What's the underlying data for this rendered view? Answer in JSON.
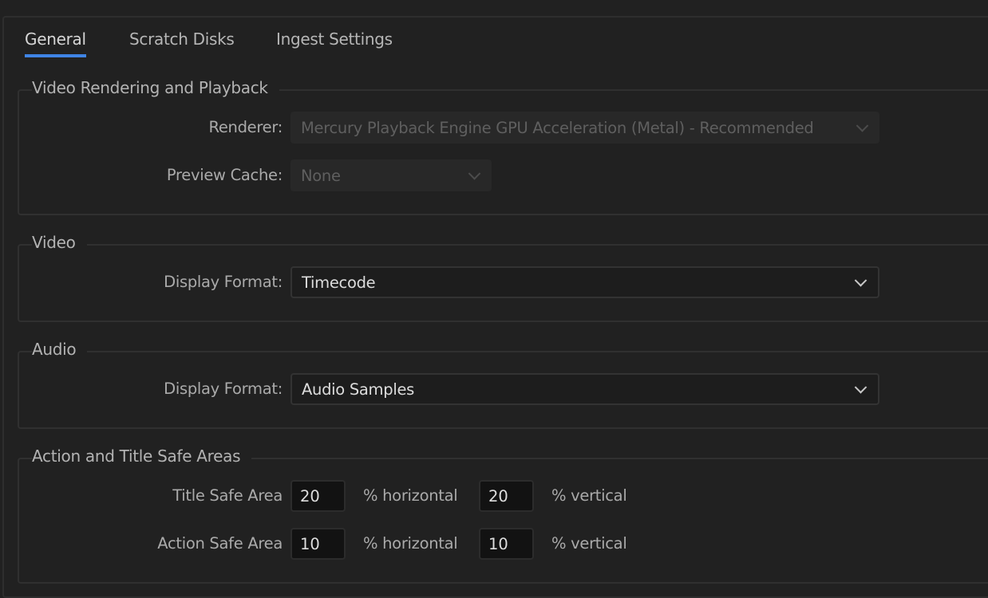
{
  "tabs": [
    {
      "label": "General",
      "active": true
    },
    {
      "label": "Scratch Disks",
      "active": false
    },
    {
      "label": "Ingest Settings",
      "active": false
    }
  ],
  "accent_color": "#3f84e5",
  "groups": {
    "rendering": {
      "title": "Video Rendering and Playback",
      "renderer_label": "Renderer:",
      "renderer_value": "Mercury Playback Engine GPU Acceleration (Metal) - Recommended",
      "preview_cache_label": "Preview Cache:",
      "preview_cache_value": "None"
    },
    "video": {
      "title": "Video",
      "display_format_label": "Display Format:",
      "display_format_value": "Timecode"
    },
    "audio": {
      "title": "Audio",
      "display_format_label": "Display Format:",
      "display_format_value": "Audio Samples"
    },
    "safe_areas": {
      "title": "Action and Title Safe Areas",
      "title_safe": {
        "label": "Title Safe Area",
        "horizontal": "20",
        "horizontal_unit": "% horizontal",
        "vertical": "20",
        "vertical_unit": "% vertical"
      },
      "action_safe": {
        "label": "Action Safe Area",
        "horizontal": "10",
        "horizontal_unit": "% horizontal",
        "vertical": "10",
        "vertical_unit": "% vertical"
      }
    }
  }
}
